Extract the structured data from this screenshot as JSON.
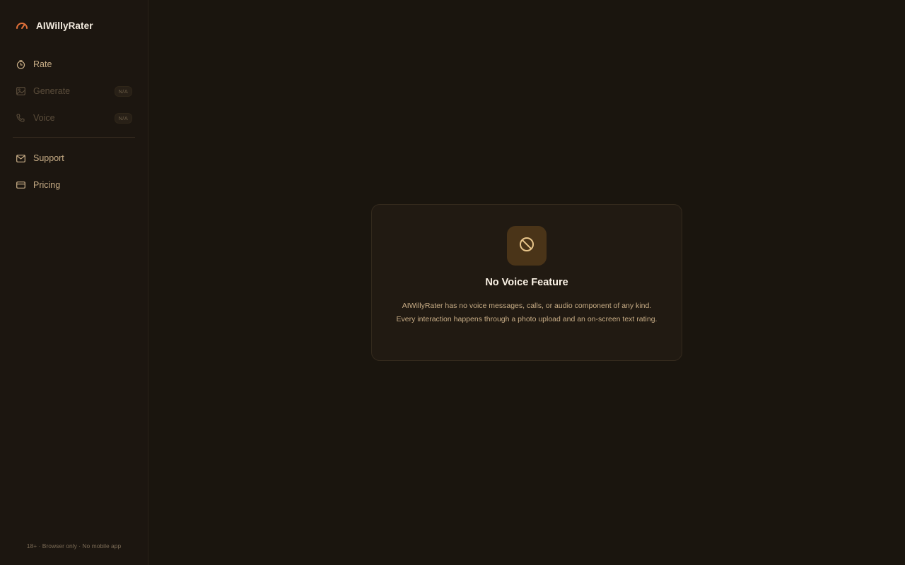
{
  "brand": {
    "name": "AIWillyRater",
    "icon": "gauge-icon",
    "accent_color": "#e2713a"
  },
  "sidebar": {
    "items": [
      {
        "label": "Rate",
        "icon": "stopwatch-icon",
        "enabled": true
      },
      {
        "label": "Generate",
        "icon": "image-icon",
        "enabled": false,
        "badge": "N/A"
      },
      {
        "label": "Voice",
        "icon": "phone-icon",
        "enabled": false,
        "badge": "N/A"
      },
      {
        "label": "Support",
        "icon": "mail-icon",
        "enabled": true
      },
      {
        "label": "Pricing",
        "icon": "credit-card-icon",
        "enabled": true
      }
    ],
    "footer": "18+ · Browser only · No mobile app"
  },
  "card": {
    "icon": "ban-icon",
    "title": "No Voice Feature",
    "description": "AIWillyRater has no voice messages, calls, or audio component of any kind. Every interaction happens through a photo upload and an on-screen text rating."
  },
  "colors": {
    "background": "#1a150e",
    "sidebar_bg": "#1c1610",
    "card_bg": "#211a12",
    "icon_box": "#4a3418",
    "icon_stroke": "#e8c58a",
    "text_muted": "#c8ad86",
    "text_disabled": "#5b4d3b"
  }
}
